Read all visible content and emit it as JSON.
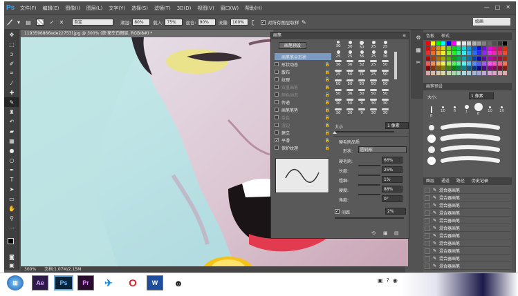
{
  "app": {
    "logo": "Ps"
  },
  "menubar": {
    "items": [
      "文件(F)",
      "编辑(E)",
      "图像(I)",
      "图层(L)",
      "文字(Y)",
      "选择(S)",
      "滤镜(T)",
      "3D(D)",
      "视图(V)",
      "窗口(W)",
      "帮助(H)"
    ]
  },
  "window_controls": [
    "—",
    "□",
    "✕"
  ],
  "options": {
    "mode_label": "自定",
    "wet_label": "潮湿:",
    "wet_value": "80%",
    "load_label": "载入:",
    "load_value": "75%",
    "mix_label": "混合:",
    "mix_value": "90%",
    "flow_label": "流量:",
    "flow_value": "100%",
    "sample_label": "对所有图层取样",
    "workspace": "绘画"
  },
  "document": {
    "tab": "1193596866ede22753l.jpg @ 300% (放·图空白图层, RGB/8#) *",
    "zoom": "300%",
    "doc_size": "文档:1.07M/2.15M"
  },
  "brush_panel": {
    "title": "画笔",
    "preset_button": "画笔预设",
    "options": [
      {
        "label": "画笔笔尖形状",
        "checked": false,
        "selected": true
      },
      {
        "label": "形状动态",
        "checked": false
      },
      {
        "label": "散布",
        "checked": false
      },
      {
        "label": "纹理",
        "checked": false
      },
      {
        "label": "双重画笔",
        "checked": false,
        "dim": true
      },
      {
        "label": "颜色动态",
        "checked": false,
        "dim": true
      },
      {
        "label": "传递",
        "checked": false
      },
      {
        "label": "画笔笔势",
        "checked": false
      },
      {
        "label": "杂色",
        "checked": false,
        "dim": true
      },
      {
        "label": "湿边",
        "checked": false,
        "dim": true
      },
      {
        "label": "建立",
        "checked": false
      },
      {
        "label": "平滑",
        "checked": true
      },
      {
        "label": "保护纹理",
        "checked": false
      }
    ],
    "tip_rows": [
      [
        "30",
        "30",
        "30",
        "25",
        "25"
      ],
      [
        "25",
        "25",
        "36",
        "25",
        "36"
      ],
      [
        "36",
        "36",
        "32",
        "25",
        "50"
      ],
      [
        "25",
        "50",
        "71",
        "25",
        "50"
      ],
      [
        "50",
        "50",
        "50",
        "50",
        "50"
      ],
      [
        "50",
        "36",
        "30",
        "50",
        "50"
      ],
      [
        "30",
        "50",
        "9",
        "30",
        "30"
      ],
      [
        "30",
        "30",
        "9",
        "30",
        "30"
      ]
    ],
    "size_label": "大小",
    "size_value": "1 像素",
    "bristle_title": "硬毛刷品质",
    "shape_label": "形状:",
    "shape_value": "圆钝形",
    "bristles_label": "硬毛刷:",
    "bristles_value": "66%",
    "length_label": "长度:",
    "length_value": "25%",
    "thickness_label": "粗细:",
    "thickness_value": "1%",
    "stiffness_label": "硬度:",
    "stiffness_value": "88%",
    "angle_label": "角度:",
    "angle_value": "0°",
    "spacing_label": "间距",
    "spacing_value": "2%"
  },
  "swatches_panel": {
    "tabs": [
      "色板",
      "样式"
    ]
  },
  "brush_presets_panel": {
    "tabs": [
      "画笔预设"
    ],
    "size_label": "大小:",
    "size_value": "1 像素",
    "tips": [
      "8",
      "10",
      "6",
      "1",
      "8",
      "10",
      "10"
    ]
  },
  "history_panel": {
    "tabs": [
      "图层",
      "通道",
      "路径",
      "历史记录"
    ],
    "items": [
      "混合器画笔",
      "混合器画笔",
      "混合器画笔",
      "混合器画笔",
      "混合器画笔",
      "混合器画笔",
      "混合器画笔",
      "混合器画笔",
      "混合器画笔",
      "混合器画笔",
      "混合器画笔"
    ]
  },
  "taskbar": {
    "apps": [
      "Ae",
      "Ps",
      "Pr",
      "W"
    ]
  }
}
